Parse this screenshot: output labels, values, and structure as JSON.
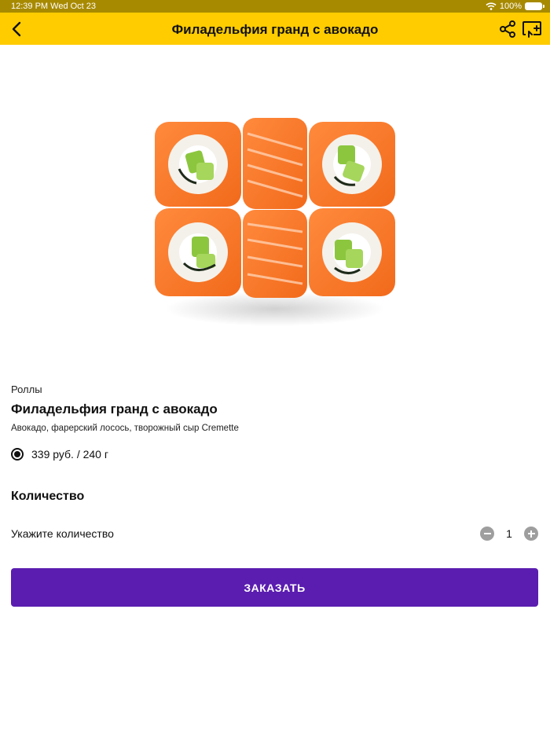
{
  "status_bar": {
    "time_date": "12:39 PM  Wed Oct 23",
    "battery": "100%",
    "wifi_icon": "wifi-icon",
    "battery_icon": "battery-icon"
  },
  "nav": {
    "title": "Филадельфия гранд с авокадо",
    "back_icon": "chevron-left-icon",
    "share_icon": "share-icon",
    "cast_icon": "cast-icon",
    "bar_color": "#ffcc00"
  },
  "product": {
    "category": "Роллы",
    "name": "Филадельфия гранд с авокадо",
    "description": "Авокадо, фарерский лосось, творожный сыр Cremette",
    "option": {
      "label": "339 руб. / 240 г",
      "selected": true
    }
  },
  "quantity": {
    "heading": "Количество",
    "label": "Укажите количество",
    "value": "1",
    "minus_icon": "minus-circle-icon",
    "plus_icon": "plus-circle-icon"
  },
  "order_button": {
    "label": "ЗАКАЗАТЬ",
    "color": "#5a1db0"
  }
}
